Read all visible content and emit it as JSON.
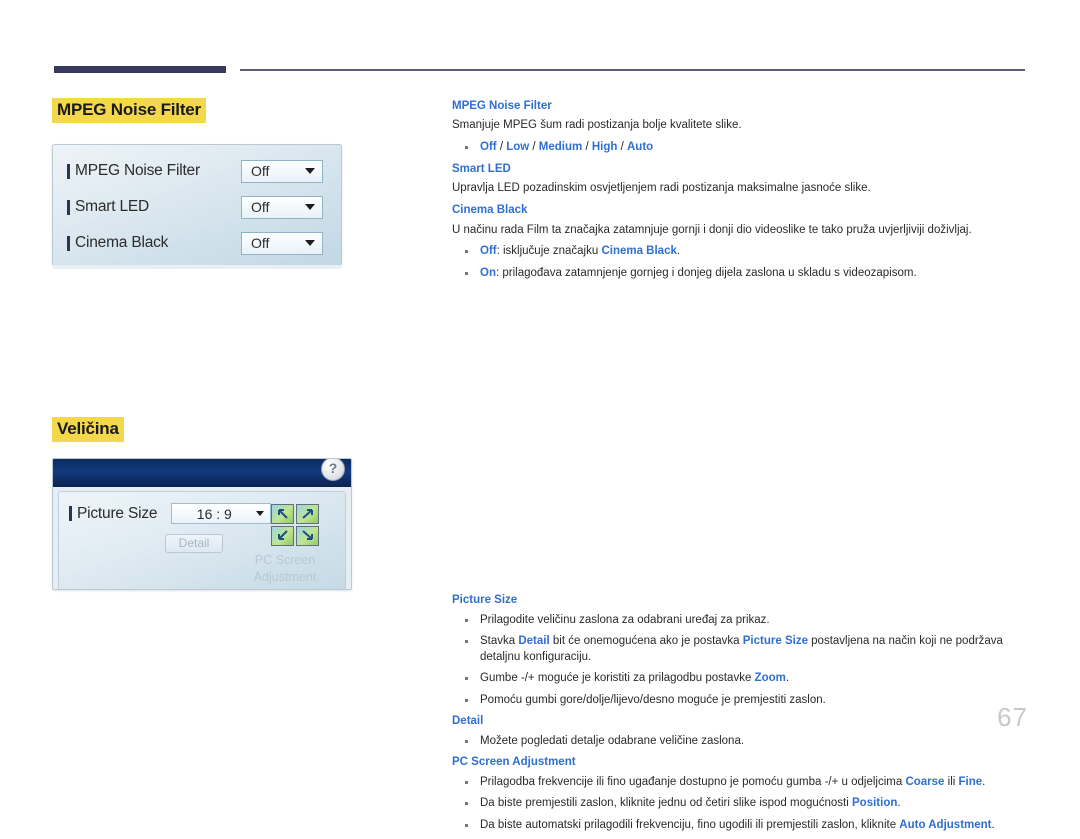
{
  "page": {
    "number": "67"
  },
  "sections": {
    "mpeg": {
      "heading": "MPEG Noise Filter"
    },
    "size": {
      "heading": "Veličina"
    }
  },
  "osd_mpeg": {
    "rows": [
      {
        "label": "MPEG Noise Filter",
        "value": "Off"
      },
      {
        "label": "Smart LED",
        "value": "Off"
      },
      {
        "label": "Cinema Black",
        "value": "Off"
      }
    ]
  },
  "osd_size": {
    "help_label": "?",
    "picture_size_label": "Picture Size",
    "picture_size_value": "16 : 9",
    "detail_button": "Detail",
    "pc_screen_adjustment": "PC Screen Adjustment"
  },
  "content": {
    "mpeg_noise_filter": {
      "heading": "MPEG Noise Filter",
      "paragraph": "Smanjuje MPEG šum radi postizanja bolje kvalitete slike.",
      "options_bullet": "Off / Low / Medium / High / Auto",
      "options": [
        "Off",
        "Low",
        "Medium",
        "High",
        "Auto"
      ]
    },
    "smart_led": {
      "heading": "Smart LED",
      "paragraph": "Upravlja LED pozadinskim osvjetljenjem radi postizanja maksimalne jasnoće slike."
    },
    "cinema_black": {
      "heading": "Cinema Black",
      "paragraph": "U načinu rada Film ta značajka zatamnjuje gornji i donji dio videoslike te tako pruža uvjerljiviji doživljaj.",
      "bullet_off_term": "Off",
      "bullet_off_text_a": ": isključuje značajku ",
      "bullet_off_term_b": "Cinema Black",
      "bullet_off_text_b": ".",
      "bullet_on_term": "On",
      "bullet_on_text": ": prilagođava zatamnjenje gornjeg i donjeg dijela zaslona u skladu s videozapisom."
    },
    "picture_size": {
      "heading": "Picture Size",
      "b1": "Prilagodite veličinu zaslona za odabrani uređaj za prikaz.",
      "b2_a": "Stavka ",
      "b2_term1": "Detail",
      "b2_b": " bit će onemogućena ako je postavka ",
      "b2_term2": "Picture Size",
      "b2_c": " postavljena na način koji ne podržava detaljnu konfiguraciju.",
      "b3_a": "Gumbe -/+ moguće je koristiti za prilagodbu postavke ",
      "b3_term": "Zoom",
      "b3_b": ".",
      "b4": "Pomoću gumbi gore/dolje/lijevo/desno moguće je premjestiti zaslon."
    },
    "detail": {
      "heading": "Detail",
      "b1": "Možete pogledati detalje odabrane veličine zaslona."
    },
    "pc_screen_adjustment": {
      "heading": "PC Screen Adjustment",
      "b1_a": "Prilagodba frekvencije ili fino ugađanje dostupno je pomoću gumba -/+ u odjeljcima ",
      "b1_term1": "Coarse",
      "b1_b": " ili ",
      "b1_term2": "Fine",
      "b1_c": ".",
      "b2_a": "Da biste premjestili zaslon, kliknite jednu od četiri slike ispod mogućnosti ",
      "b2_term": "Position",
      "b2_b": ".",
      "b3_a": "Da biste automatski prilagodili frekvenciju, fino ugodili ili premjestili zaslon, kliknite ",
      "b3_term": "Auto Adjustment",
      "b3_b": "."
    }
  },
  "colors": {
    "highlight": "#f3d84b",
    "link_blue": "#2f6fd0",
    "rule_navy": "#373a5c",
    "titlebar_navy": "#123a7e",
    "page_number_gray": "#c9c9c9"
  }
}
